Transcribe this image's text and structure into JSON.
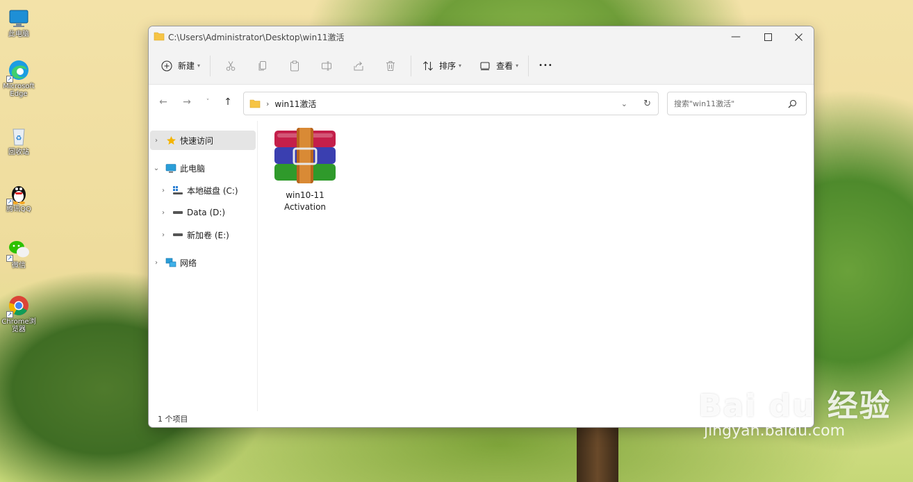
{
  "desktop": {
    "icons": [
      {
        "label": "此电脑"
      },
      {
        "label": "Microsoft Edge"
      },
      {
        "label": "回收站"
      },
      {
        "label": "腾讯QQ"
      },
      {
        "label": "微信"
      },
      {
        "label": "Chrome浏览器"
      }
    ]
  },
  "window": {
    "title": "C:\\Users\\Administrator\\Desktop\\win11激活",
    "toolbar": {
      "new_label": "新建",
      "sort_label": "排序",
      "view_label": "查看",
      "more_label": "•••"
    },
    "address": {
      "crumb": "win11激活"
    },
    "search": {
      "placeholder": "搜索\"win11激活\""
    },
    "sidebar": {
      "quick_access": "快速访问",
      "this_pc": "此电脑",
      "drive_c": "本地磁盘 (C:)",
      "drive_d": "Data (D:)",
      "drive_e": "新加卷 (E:)",
      "network": "网络"
    },
    "files": [
      {
        "name_line1": "win10-11",
        "name_line2": "Activation"
      }
    ],
    "status": "1 个项目"
  },
  "watermark": {
    "brand": "Bai du 经验",
    "url": "jingyan.baidu.com"
  },
  "colors": {
    "accent": "#0067c0",
    "folder": "#f6c445",
    "window_bg": "#f3f3f3"
  }
}
